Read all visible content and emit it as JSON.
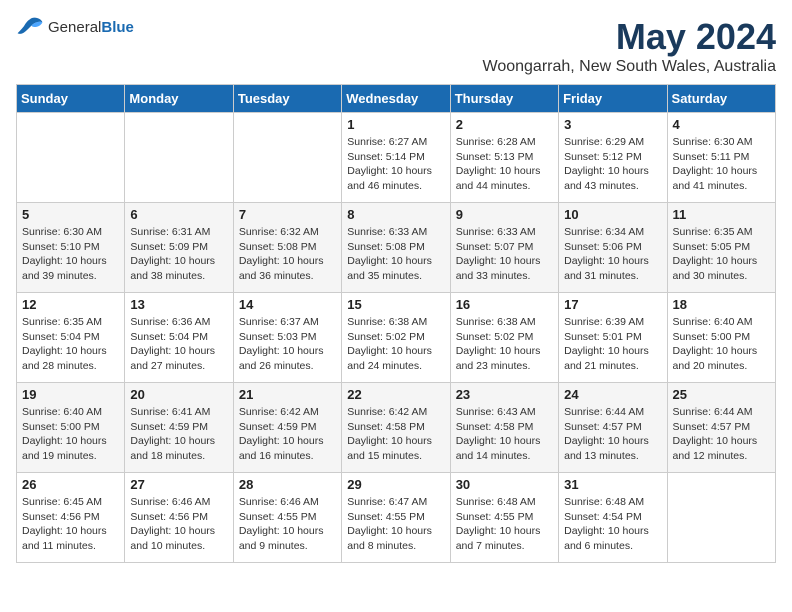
{
  "header": {
    "logo_general": "General",
    "logo_blue": "Blue",
    "month_title": "May 2024",
    "location": "Woongarrah, New South Wales, Australia"
  },
  "weekdays": [
    "Sunday",
    "Monday",
    "Tuesday",
    "Wednesday",
    "Thursday",
    "Friday",
    "Saturday"
  ],
  "weeks": [
    [
      {
        "day": "",
        "content": ""
      },
      {
        "day": "",
        "content": ""
      },
      {
        "day": "",
        "content": ""
      },
      {
        "day": "1",
        "content": "Sunrise: 6:27 AM\nSunset: 5:14 PM\nDaylight: 10 hours\nand 46 minutes."
      },
      {
        "day": "2",
        "content": "Sunrise: 6:28 AM\nSunset: 5:13 PM\nDaylight: 10 hours\nand 44 minutes."
      },
      {
        "day": "3",
        "content": "Sunrise: 6:29 AM\nSunset: 5:12 PM\nDaylight: 10 hours\nand 43 minutes."
      },
      {
        "day": "4",
        "content": "Sunrise: 6:30 AM\nSunset: 5:11 PM\nDaylight: 10 hours\nand 41 minutes."
      }
    ],
    [
      {
        "day": "5",
        "content": "Sunrise: 6:30 AM\nSunset: 5:10 PM\nDaylight: 10 hours\nand 39 minutes."
      },
      {
        "day": "6",
        "content": "Sunrise: 6:31 AM\nSunset: 5:09 PM\nDaylight: 10 hours\nand 38 minutes."
      },
      {
        "day": "7",
        "content": "Sunrise: 6:32 AM\nSunset: 5:08 PM\nDaylight: 10 hours\nand 36 minutes."
      },
      {
        "day": "8",
        "content": "Sunrise: 6:33 AM\nSunset: 5:08 PM\nDaylight: 10 hours\nand 35 minutes."
      },
      {
        "day": "9",
        "content": "Sunrise: 6:33 AM\nSunset: 5:07 PM\nDaylight: 10 hours\nand 33 minutes."
      },
      {
        "day": "10",
        "content": "Sunrise: 6:34 AM\nSunset: 5:06 PM\nDaylight: 10 hours\nand 31 minutes."
      },
      {
        "day": "11",
        "content": "Sunrise: 6:35 AM\nSunset: 5:05 PM\nDaylight: 10 hours\nand 30 minutes."
      }
    ],
    [
      {
        "day": "12",
        "content": "Sunrise: 6:35 AM\nSunset: 5:04 PM\nDaylight: 10 hours\nand 28 minutes."
      },
      {
        "day": "13",
        "content": "Sunrise: 6:36 AM\nSunset: 5:04 PM\nDaylight: 10 hours\nand 27 minutes."
      },
      {
        "day": "14",
        "content": "Sunrise: 6:37 AM\nSunset: 5:03 PM\nDaylight: 10 hours\nand 26 minutes."
      },
      {
        "day": "15",
        "content": "Sunrise: 6:38 AM\nSunset: 5:02 PM\nDaylight: 10 hours\nand 24 minutes."
      },
      {
        "day": "16",
        "content": "Sunrise: 6:38 AM\nSunset: 5:02 PM\nDaylight: 10 hours\nand 23 minutes."
      },
      {
        "day": "17",
        "content": "Sunrise: 6:39 AM\nSunset: 5:01 PM\nDaylight: 10 hours\nand 21 minutes."
      },
      {
        "day": "18",
        "content": "Sunrise: 6:40 AM\nSunset: 5:00 PM\nDaylight: 10 hours\nand 20 minutes."
      }
    ],
    [
      {
        "day": "19",
        "content": "Sunrise: 6:40 AM\nSunset: 5:00 PM\nDaylight: 10 hours\nand 19 minutes."
      },
      {
        "day": "20",
        "content": "Sunrise: 6:41 AM\nSunset: 4:59 PM\nDaylight: 10 hours\nand 18 minutes."
      },
      {
        "day": "21",
        "content": "Sunrise: 6:42 AM\nSunset: 4:59 PM\nDaylight: 10 hours\nand 16 minutes."
      },
      {
        "day": "22",
        "content": "Sunrise: 6:42 AM\nSunset: 4:58 PM\nDaylight: 10 hours\nand 15 minutes."
      },
      {
        "day": "23",
        "content": "Sunrise: 6:43 AM\nSunset: 4:58 PM\nDaylight: 10 hours\nand 14 minutes."
      },
      {
        "day": "24",
        "content": "Sunrise: 6:44 AM\nSunset: 4:57 PM\nDaylight: 10 hours\nand 13 minutes."
      },
      {
        "day": "25",
        "content": "Sunrise: 6:44 AM\nSunset: 4:57 PM\nDaylight: 10 hours\nand 12 minutes."
      }
    ],
    [
      {
        "day": "26",
        "content": "Sunrise: 6:45 AM\nSunset: 4:56 PM\nDaylight: 10 hours\nand 11 minutes."
      },
      {
        "day": "27",
        "content": "Sunrise: 6:46 AM\nSunset: 4:56 PM\nDaylight: 10 hours\nand 10 minutes."
      },
      {
        "day": "28",
        "content": "Sunrise: 6:46 AM\nSunset: 4:55 PM\nDaylight: 10 hours\nand 9 minutes."
      },
      {
        "day": "29",
        "content": "Sunrise: 6:47 AM\nSunset: 4:55 PM\nDaylight: 10 hours\nand 8 minutes."
      },
      {
        "day": "30",
        "content": "Sunrise: 6:48 AM\nSunset: 4:55 PM\nDaylight: 10 hours\nand 7 minutes."
      },
      {
        "day": "31",
        "content": "Sunrise: 6:48 AM\nSunset: 4:54 PM\nDaylight: 10 hours\nand 6 minutes."
      },
      {
        "day": "",
        "content": ""
      }
    ]
  ]
}
